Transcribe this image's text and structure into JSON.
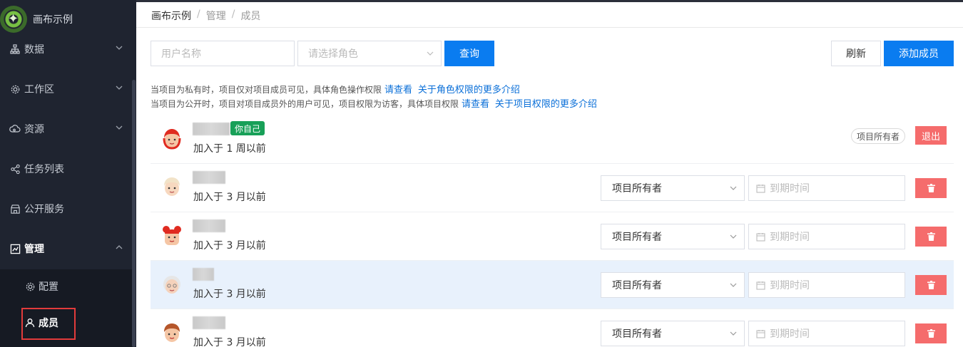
{
  "app": {
    "title": "画布示例"
  },
  "sidebar": {
    "items": [
      {
        "label": "数据",
        "icon": "data-tree-icon"
      },
      {
        "label": "工作区",
        "icon": "gear-icon"
      },
      {
        "label": "资源",
        "icon": "cloud-icon"
      },
      {
        "label": "任务列表",
        "icon": "share-nodes-icon"
      },
      {
        "label": "公开服务",
        "icon": "storefront-icon"
      },
      {
        "label": "管理",
        "icon": "chart-box-icon"
      }
    ],
    "subitems": [
      {
        "label": "配置",
        "icon": "gear-icon"
      },
      {
        "label": "成员",
        "icon": "user-icon"
      }
    ]
  },
  "breadcrumb": [
    "画布示例",
    "管理",
    "成员"
  ],
  "breadcrumb_sep": "/",
  "filters": {
    "username_placeholder": "用户名称",
    "role_placeholder": "请选择角色",
    "search_label": "查询",
    "refresh_label": "刷新",
    "add_label": "添加成员"
  },
  "notices": [
    {
      "text": "当项目为私有时，项目仅对项目成员可见，具体角色操作权限",
      "link1": "请查看",
      "link2": "关于角色权限的更多介绍"
    },
    {
      "text": "当项目为公开时，项目对项目成员外的用户可见，项目权限为访客，具体项目权限",
      "link1": "请查看",
      "link2": "关于项目权限的更多介绍"
    }
  ],
  "members": [
    {
      "joined": "加入于 1 周以前",
      "self_tag": "你自己",
      "role_tag": "项目所有者",
      "action": "退出"
    },
    {
      "joined": "加入于 3 月以前",
      "role": "项目所有者",
      "date_placeholder": "到期时间"
    },
    {
      "joined": "加入于 3 月以前",
      "role": "项目所有者",
      "date_placeholder": "到期时间"
    },
    {
      "joined": "加入于 3 月以前",
      "role": "项目所有者",
      "date_placeholder": "到期时间"
    },
    {
      "joined": "加入于 3 月以前",
      "role": "项目所有者",
      "date_placeholder": "到期时间"
    }
  ],
  "colors": {
    "primary": "#0a7cf0",
    "danger": "#f56c6c",
    "success": "#18a058",
    "sidebar_bg": "#1f2430"
  }
}
